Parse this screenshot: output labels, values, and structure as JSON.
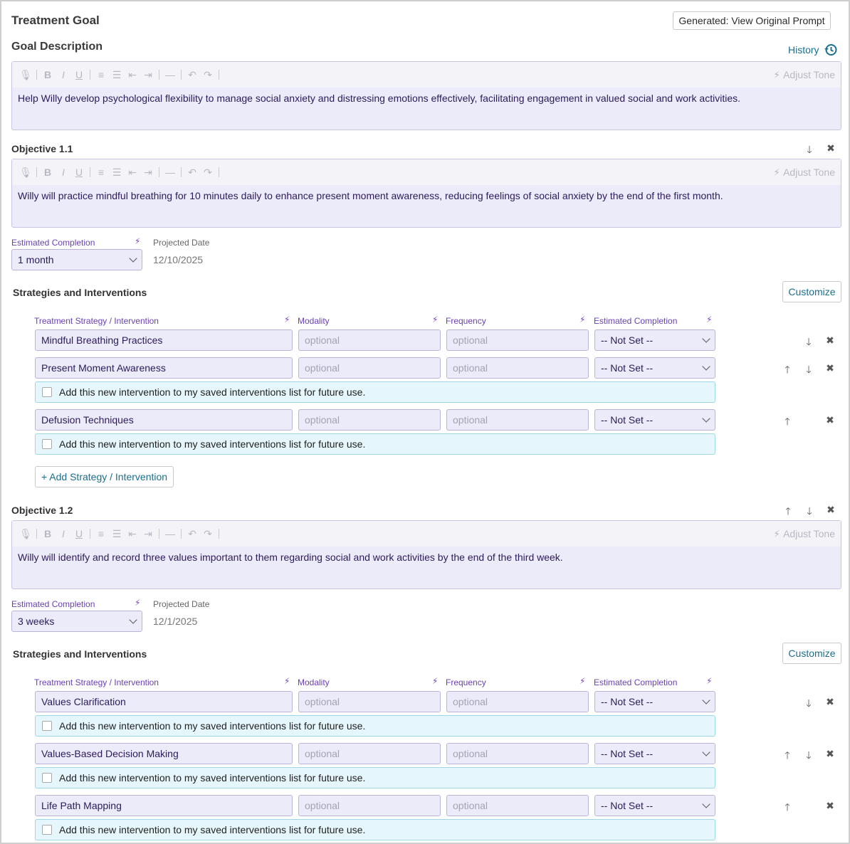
{
  "header": {
    "title": "Treatment Goal",
    "generated_button": "Generated: View Original Prompt"
  },
  "goal": {
    "label": "Goal Description",
    "history_label": "History",
    "adjust_tone": "Adjust Tone",
    "text": "Help Willy develop psychological flexibility to manage social anxiety and distressing emotions effectively, facilitating engagement in valued social and work activities."
  },
  "common": {
    "estimated_completion_label": "Estimated Completion",
    "projected_date_label": "Projected Date",
    "strategies_title": "Strategies and Interventions",
    "customize_button": "Customize",
    "col_strategy": "Treatment Strategy / Intervention",
    "col_modality": "Modality",
    "col_frequency": "Frequency",
    "col_completion": "Estimated Completion",
    "optional_placeholder": "optional",
    "not_set": "-- Not Set --",
    "save_intervention": "Add this new intervention to my saved interventions list for future use.",
    "add_strategy": "+ Add Strategy / Intervention"
  },
  "objectives": [
    {
      "title": "Objective 1.1",
      "text": "Willy will practice mindful breathing for 10 minutes daily to enhance present moment awareness, reducing feelings of social anxiety by the end of the first month.",
      "estimated_completion": "1 month",
      "projected_date": "12/10/2025",
      "strategies": [
        {
          "name": "Mindful Breathing Practices"
        },
        {
          "name": "Present Moment Awareness"
        },
        {
          "name": "Defusion Techniques"
        }
      ]
    },
    {
      "title": "Objective 1.2",
      "text": "Willy will identify and record three values important to them regarding social and work activities by the end of the third week.",
      "estimated_completion": "3 weeks",
      "projected_date": "12/1/2025",
      "strategies": [
        {
          "name": "Values Clarification"
        },
        {
          "name": "Values-Based Decision Making"
        },
        {
          "name": "Life Path Mapping"
        }
      ]
    }
  ]
}
